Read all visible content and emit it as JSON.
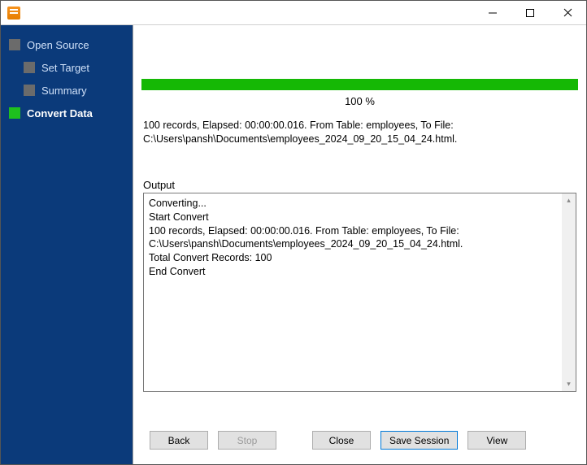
{
  "sidebar": {
    "items": [
      {
        "label": "Open Source",
        "level": 0,
        "active": false
      },
      {
        "label": "Set Target",
        "level": 1,
        "active": false
      },
      {
        "label": "Summary",
        "level": 1,
        "active": false
      },
      {
        "label": "Convert Data",
        "level": 0,
        "active": true
      }
    ]
  },
  "progress": {
    "percent": 100,
    "percent_label": "100 %"
  },
  "status": {
    "line1": "100 records,    Elapsed: 00:00:00.016.    From Table: employees,    To File:",
    "line2": "C:\\Users\\pansh\\Documents\\employees_2024_09_20_15_04_24.html."
  },
  "output": {
    "label": "Output",
    "lines": [
      "Converting...",
      "Start Convert",
      "100 records,    Elapsed: 00:00:00.016.    From Table: employees,    To File: C:\\Users\\pansh\\Documents\\employees_2024_09_20_15_04_24.html.",
      "Total Convert Records: 100",
      "End Convert"
    ]
  },
  "buttons": {
    "back": "Back",
    "stop": "Stop",
    "close": "Close",
    "save_session": "Save Session",
    "view": "View"
  }
}
